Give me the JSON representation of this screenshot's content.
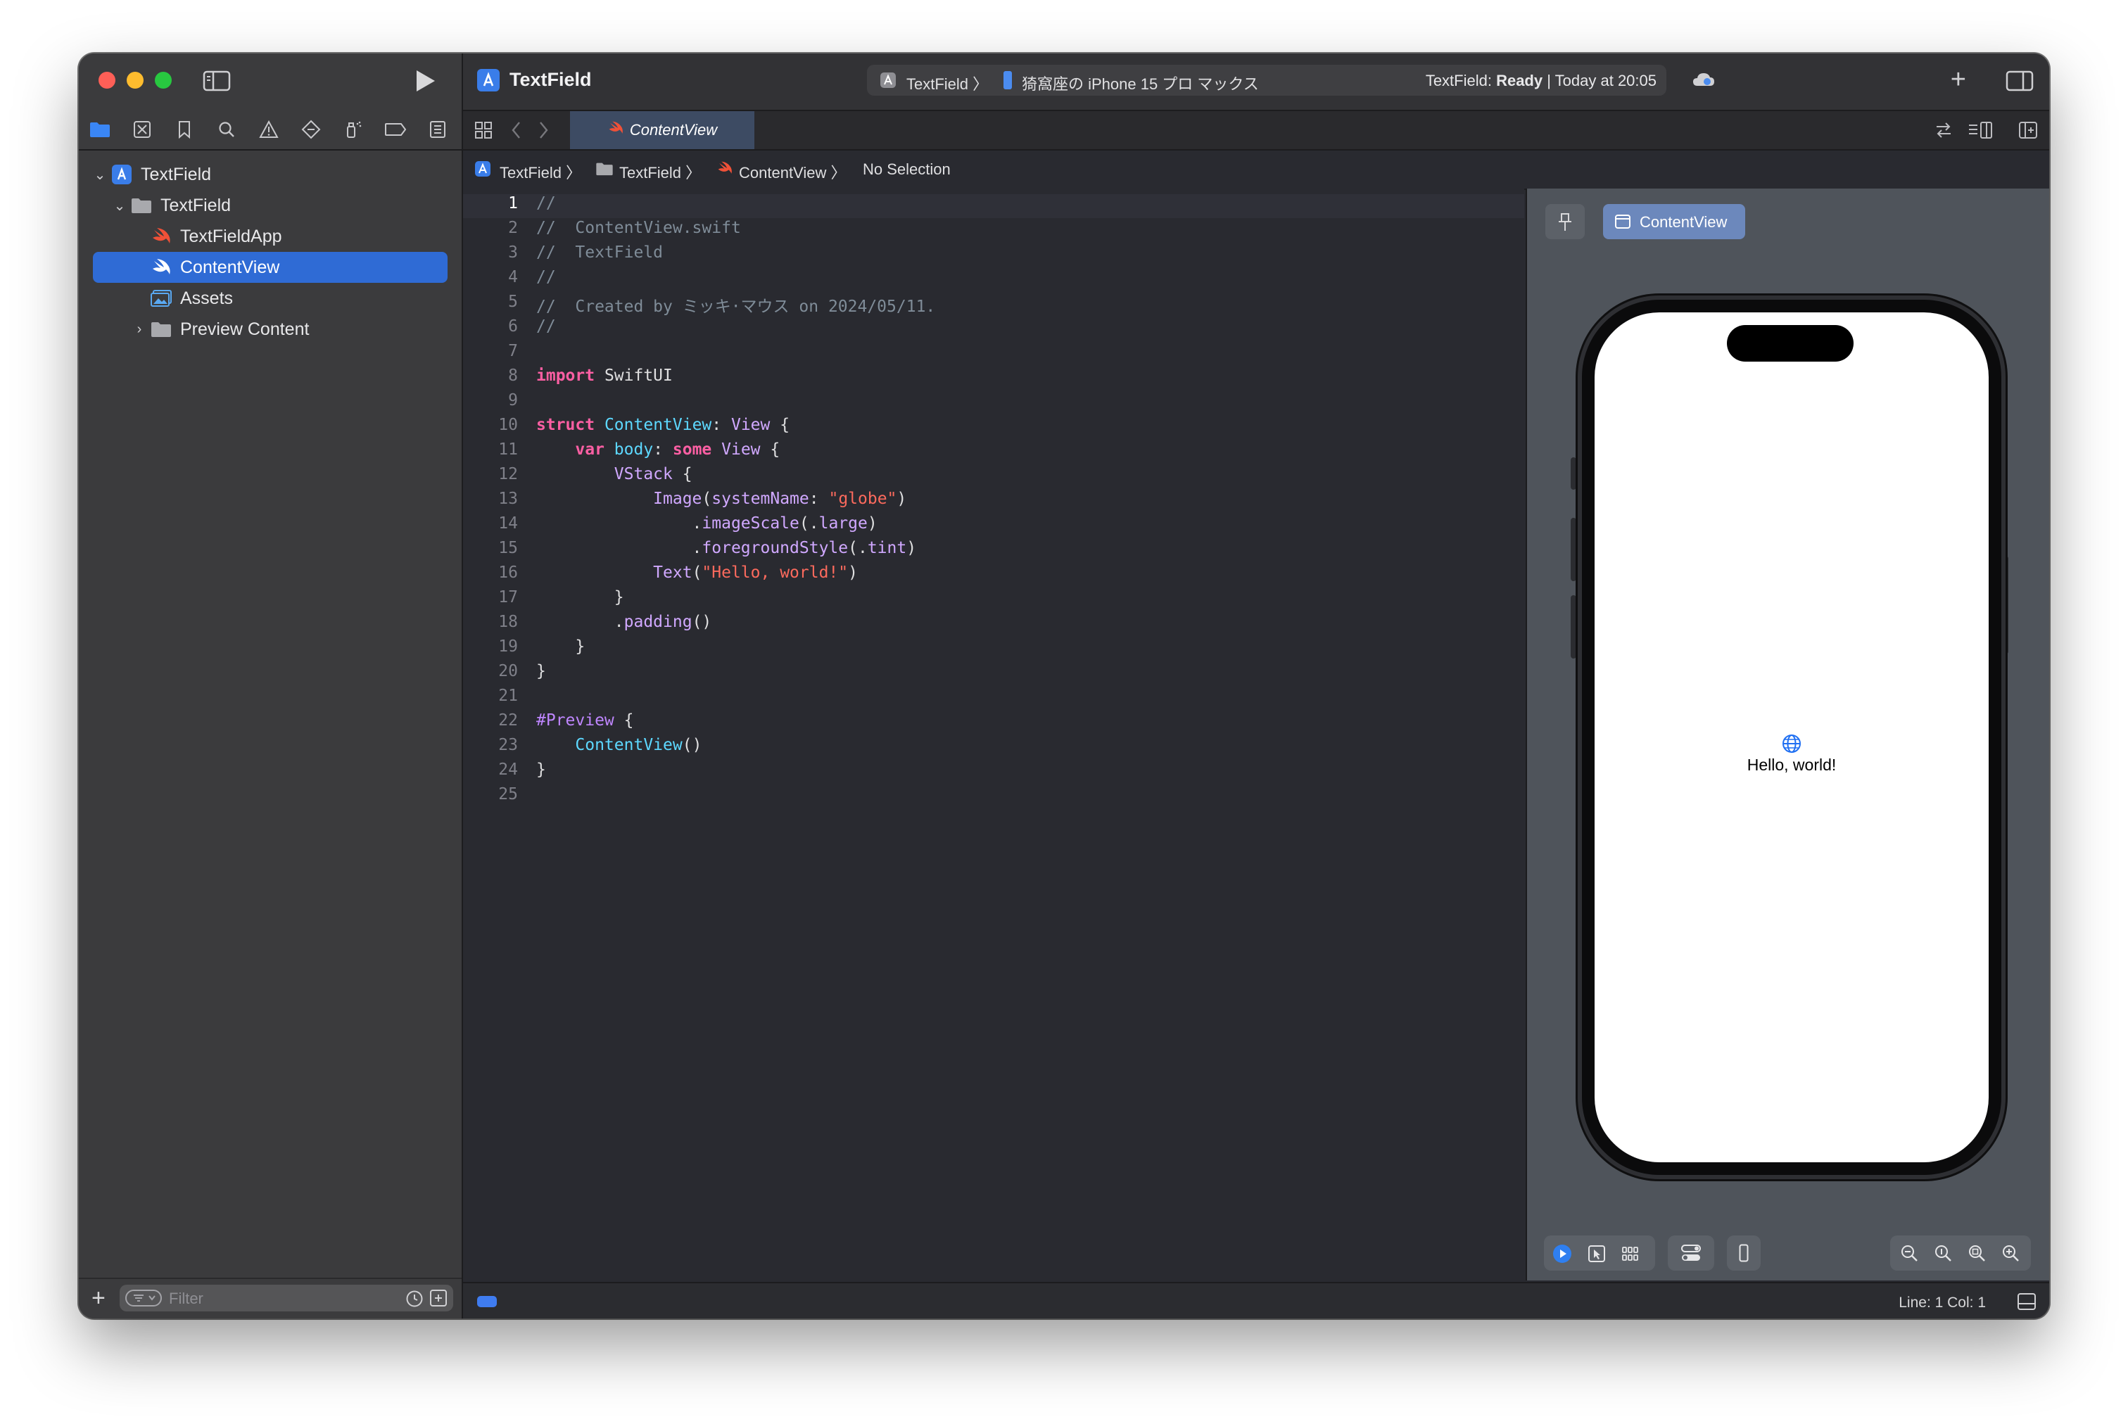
{
  "navigator": {
    "items": [
      {
        "label": "TextField",
        "level": 0,
        "expanded": true,
        "icon": "project-icon"
      },
      {
        "label": "TextField",
        "level": 1,
        "expanded": true,
        "icon": "folder-icon"
      },
      {
        "label": "TextFieldApp",
        "level": 2,
        "icon": "swift-file-icon"
      },
      {
        "label": "ContentView",
        "level": 2,
        "icon": "swift-file-icon",
        "selected": true
      },
      {
        "label": "Assets",
        "level": 2,
        "icon": "asset-catalog-icon"
      },
      {
        "label": "Preview Content",
        "level": 2,
        "expanded": false,
        "icon": "folder-icon"
      }
    ],
    "filter_placeholder": "Filter"
  },
  "toolbar": {
    "project_title": "TextField",
    "scheme_target": "TextField",
    "scheme_device": "猗窩座の iPhone 15 プロ マックス",
    "status_prefix": "TextField: ",
    "status_state": "Ready",
    "status_time": " | Today at 20:05"
  },
  "tab": {
    "label": "ContentView"
  },
  "jumpbar": {
    "crumbs": [
      "TextField",
      "TextField",
      "ContentView",
      "No Selection"
    ]
  },
  "code": {
    "current_line": 1,
    "lines": [
      {
        "n": 1,
        "parts": [
          {
            "t": "//",
            "c": "comment"
          }
        ]
      },
      {
        "n": 2,
        "parts": [
          {
            "t": "//  ContentView.swift",
            "c": "comment"
          }
        ]
      },
      {
        "n": 3,
        "parts": [
          {
            "t": "//  TextField",
            "c": "comment"
          }
        ]
      },
      {
        "n": 4,
        "parts": [
          {
            "t": "//",
            "c": "comment"
          }
        ]
      },
      {
        "n": 5,
        "parts": [
          {
            "t": "//  Created by ミッキ·マウス on 2024/05/11.",
            "c": "comment"
          }
        ]
      },
      {
        "n": 6,
        "parts": [
          {
            "t": "//",
            "c": "comment"
          }
        ]
      },
      {
        "n": 7,
        "parts": []
      },
      {
        "n": 8,
        "parts": [
          {
            "t": "import",
            "c": "kw"
          },
          {
            "t": " SwiftUI",
            "c": "plain"
          }
        ]
      },
      {
        "n": 9,
        "parts": []
      },
      {
        "n": 10,
        "parts": [
          {
            "t": "struct",
            "c": "kw"
          },
          {
            "t": " ",
            "c": "plain"
          },
          {
            "t": "ContentView",
            "c": "type"
          },
          {
            "t": ": ",
            "c": "plain"
          },
          {
            "t": "View",
            "c": "type2"
          },
          {
            "t": " {",
            "c": "plain"
          }
        ]
      },
      {
        "n": 11,
        "parts": [
          {
            "t": "    ",
            "c": "plain"
          },
          {
            "t": "var",
            "c": "kw"
          },
          {
            "t": " ",
            "c": "plain"
          },
          {
            "t": "body",
            "c": "type"
          },
          {
            "t": ": ",
            "c": "plain"
          },
          {
            "t": "some",
            "c": "kw"
          },
          {
            "t": " ",
            "c": "plain"
          },
          {
            "t": "View",
            "c": "type2"
          },
          {
            "t": " {",
            "c": "plain"
          }
        ]
      },
      {
        "n": 12,
        "parts": [
          {
            "t": "        ",
            "c": "plain"
          },
          {
            "t": "VStack",
            "c": "type2"
          },
          {
            "t": " {",
            "c": "plain"
          }
        ]
      },
      {
        "n": 13,
        "parts": [
          {
            "t": "            ",
            "c": "plain"
          },
          {
            "t": "Image",
            "c": "type2"
          },
          {
            "t": "(",
            "c": "plain"
          },
          {
            "t": "systemName",
            "c": "type2"
          },
          {
            "t": ": ",
            "c": "plain"
          },
          {
            "t": "\"globe\"",
            "c": "str"
          },
          {
            "t": ")",
            "c": "plain"
          }
        ]
      },
      {
        "n": 14,
        "parts": [
          {
            "t": "                .",
            "c": "plain"
          },
          {
            "t": "imageScale",
            "c": "type2"
          },
          {
            "t": "(.",
            "c": "plain"
          },
          {
            "t": "large",
            "c": "type2"
          },
          {
            "t": ")",
            "c": "plain"
          }
        ]
      },
      {
        "n": 15,
        "parts": [
          {
            "t": "                .",
            "c": "plain"
          },
          {
            "t": "foregroundStyle",
            "c": "type2"
          },
          {
            "t": "(.",
            "c": "plain"
          },
          {
            "t": "tint",
            "c": "type2"
          },
          {
            "t": ")",
            "c": "plain"
          }
        ]
      },
      {
        "n": 16,
        "parts": [
          {
            "t": "            ",
            "c": "plain"
          },
          {
            "t": "Text",
            "c": "type2"
          },
          {
            "t": "(",
            "c": "plain"
          },
          {
            "t": "\"Hello, world!\"",
            "c": "str"
          },
          {
            "t": ")",
            "c": "plain"
          }
        ]
      },
      {
        "n": 17,
        "parts": [
          {
            "t": "        }",
            "c": "plain"
          }
        ]
      },
      {
        "n": 18,
        "parts": [
          {
            "t": "        .",
            "c": "plain"
          },
          {
            "t": "padding",
            "c": "type2"
          },
          {
            "t": "()",
            "c": "plain"
          }
        ]
      },
      {
        "n": 19,
        "parts": [
          {
            "t": "    }",
            "c": "plain"
          }
        ]
      },
      {
        "n": 20,
        "parts": [
          {
            "t": "}",
            "c": "plain"
          }
        ]
      },
      {
        "n": 21,
        "parts": []
      },
      {
        "n": 22,
        "parts": [
          {
            "t": "#Preview",
            "c": "macro"
          },
          {
            "t": " {",
            "c": "plain"
          }
        ]
      },
      {
        "n": 23,
        "parts": [
          {
            "t": "    ",
            "c": "plain"
          },
          {
            "t": "ContentView",
            "c": "type"
          },
          {
            "t": "()",
            "c": "plain"
          }
        ]
      },
      {
        "n": 24,
        "parts": [
          {
            "t": "}",
            "c": "plain"
          }
        ]
      },
      {
        "n": 25,
        "parts": []
      }
    ]
  },
  "preview": {
    "chip_label": "ContentView",
    "hello_text": "Hello, world!"
  },
  "statusbar": {
    "line_col": "Line: 1  Col: 1"
  },
  "colors": {
    "accent": "#2f6bd5",
    "keyword": "#fc5fa3",
    "type": "#5dd8ff",
    "member": "#d0a8ff",
    "string": "#fc6a5d",
    "comment": "#7f8c98"
  }
}
